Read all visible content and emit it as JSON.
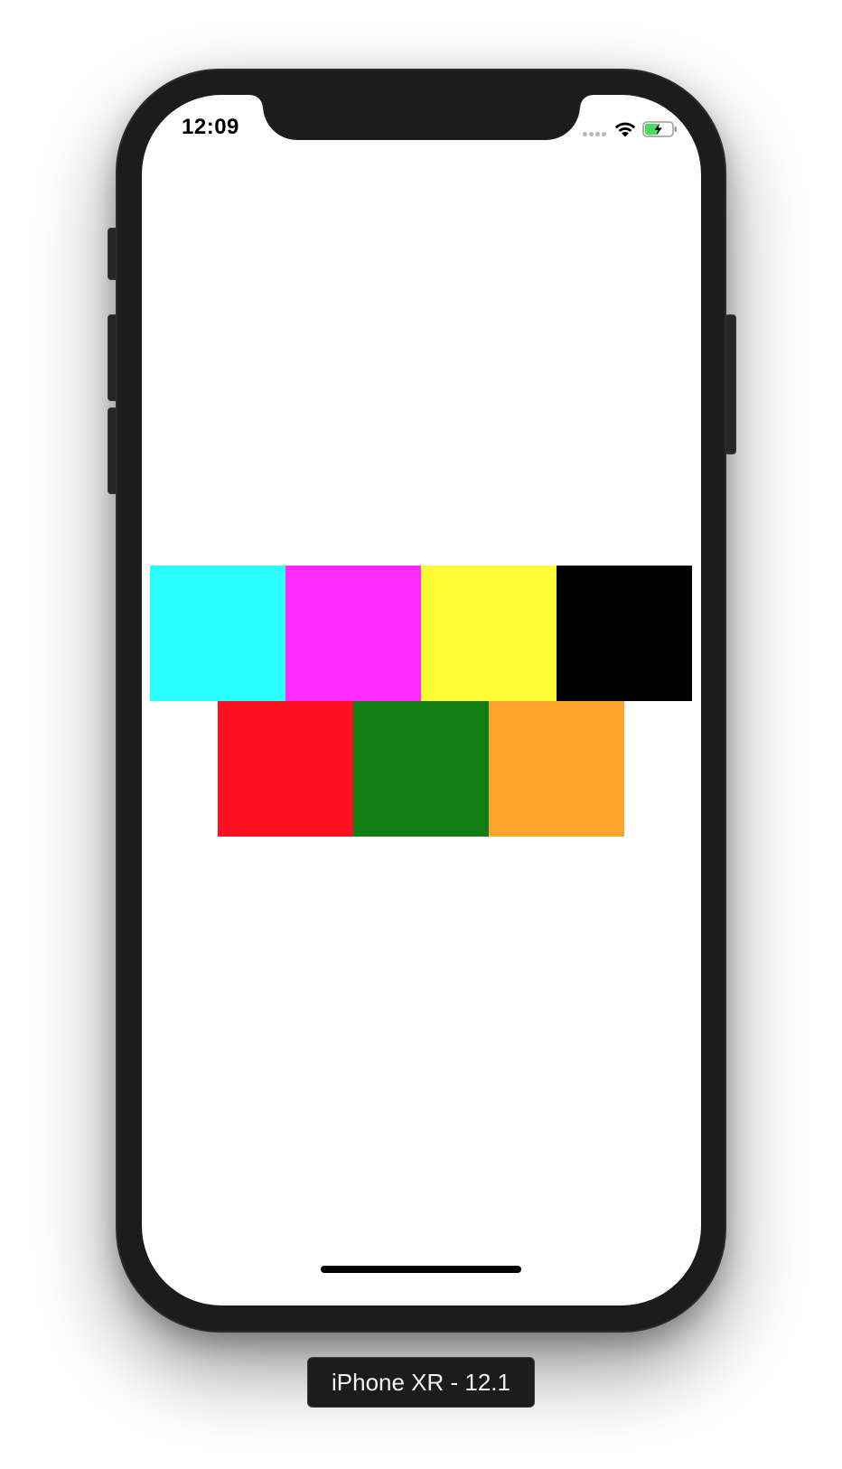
{
  "status_bar": {
    "time": "12:09",
    "wifi_icon": "wifi-icon",
    "battery_icon": "battery-charging-icon",
    "signal_icon": "cellular-signal-icon"
  },
  "screen": {
    "top_row": [
      {
        "name": "cyan",
        "color": "#2bfefe"
      },
      {
        "name": "magenta",
        "color": "#fd2bfe"
      },
      {
        "name": "yellow",
        "color": "#fefd36"
      },
      {
        "name": "black",
        "color": "#000000"
      }
    ],
    "bottom_row": [
      {
        "name": "red",
        "color": "#fd101f"
      },
      {
        "name": "green",
        "color": "#127f14"
      },
      {
        "name": "orange",
        "color": "#fda22b"
      }
    ]
  },
  "device_label": "iPhone XR - 12.1"
}
